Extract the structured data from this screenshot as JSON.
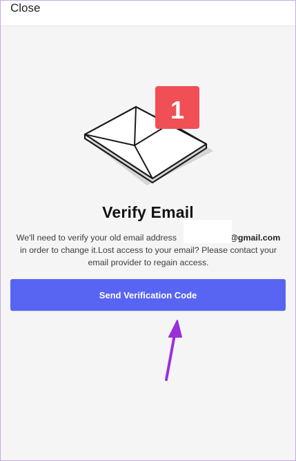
{
  "header": {
    "close_label": "Close"
  },
  "illustration": {
    "badge_count": "1",
    "badge_color": "#f04f55"
  },
  "main": {
    "title": "Verify Email",
    "desc_line1_prefix": "We'll need to verify your old email address",
    "desc_line1_domain": "a@gmail.com",
    "desc_line2": "in order to change it.Lost access to your email? Please contact your",
    "desc_line3": "email provider to regain access.",
    "button_label": "Send Verification Code"
  },
  "colors": {
    "accent": "#5865f2",
    "annotation_arrow": "#9b30d9"
  }
}
